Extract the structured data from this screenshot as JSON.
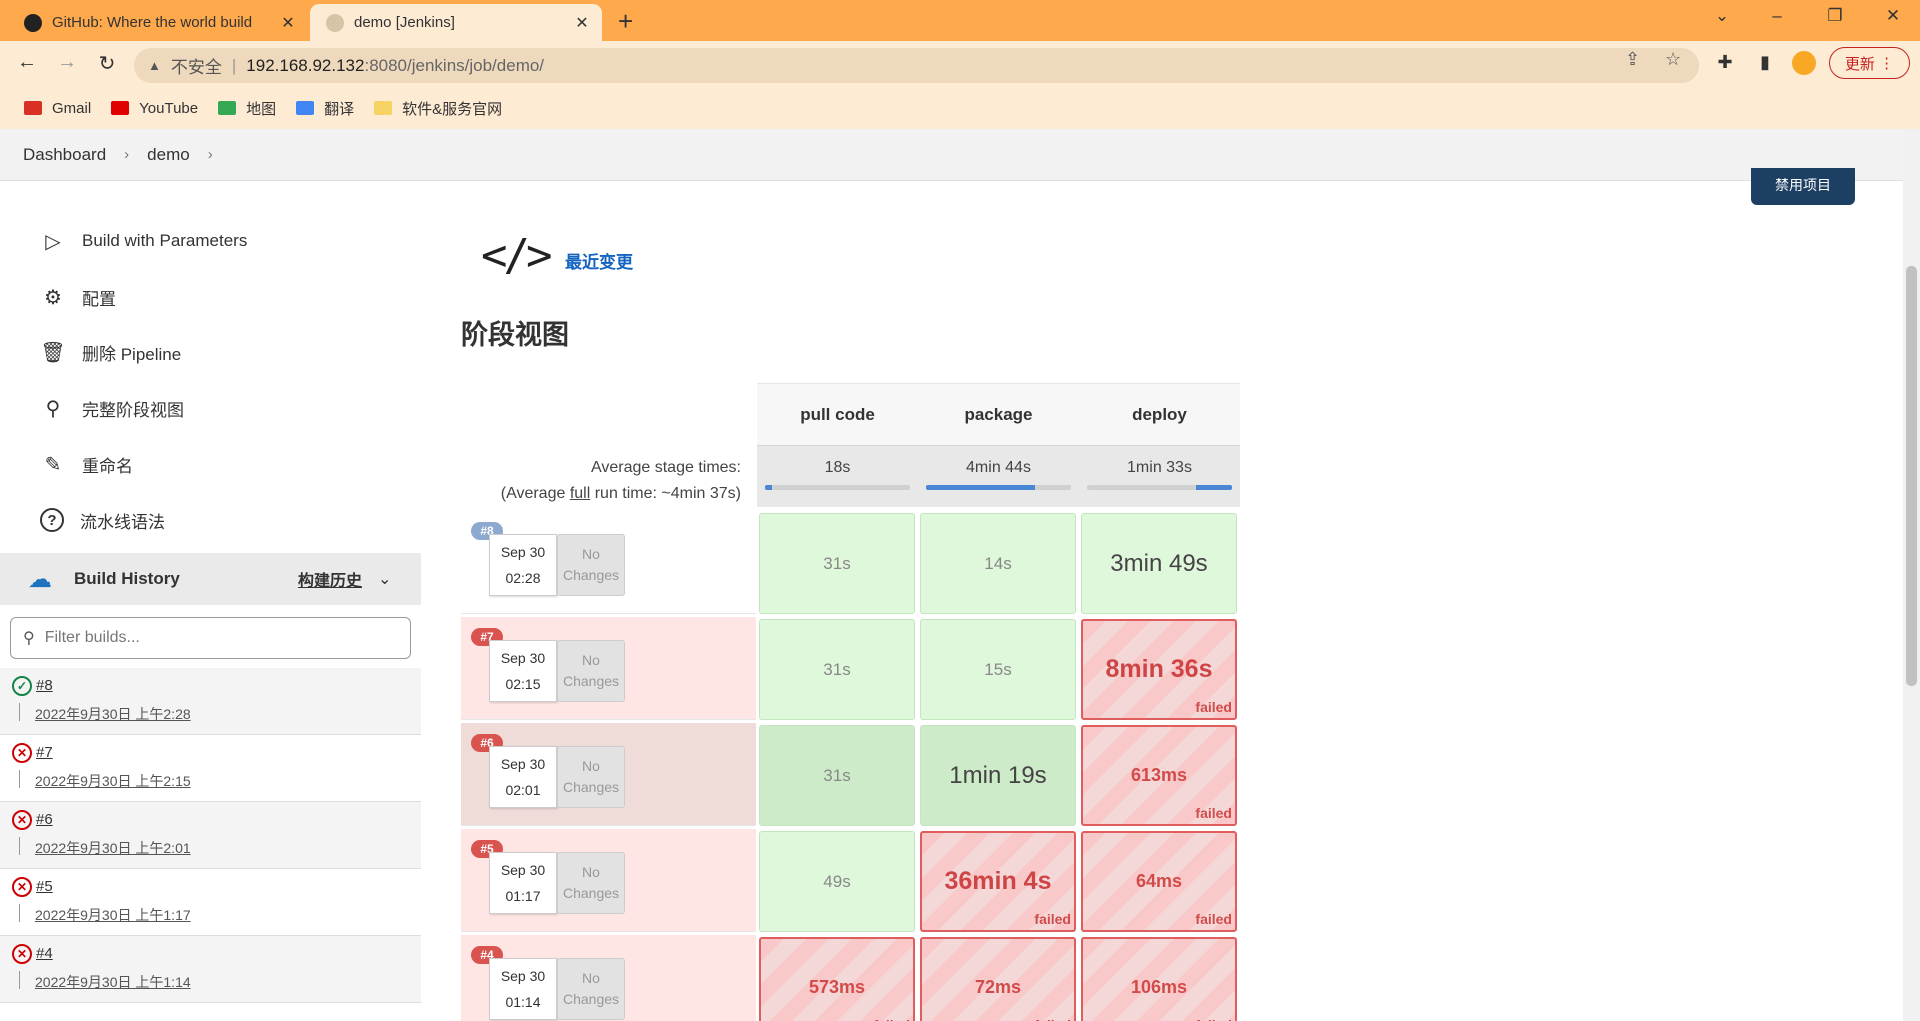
{
  "browser": {
    "tabs": [
      {
        "title": "GitHub: Where the world build",
        "active": false
      },
      {
        "title": "demo [Jenkins]",
        "active": true
      }
    ],
    "address": {
      "insecure_label": "不安全",
      "host": "192.168.92.132",
      "path": ":8080/jenkins/job/demo/"
    },
    "update_label": "更新",
    "bookmarks": [
      {
        "label": "Gmail",
        "icon": "gmail-icon",
        "color": "#d93025"
      },
      {
        "label": "YouTube",
        "icon": "youtube-icon",
        "color": "#e00000"
      },
      {
        "label": "地图",
        "icon": "maps-icon",
        "color": "#34a853"
      },
      {
        "label": "翻译",
        "icon": "translate-icon",
        "color": "#4285f4"
      },
      {
        "label": "软件&服务官网",
        "icon": "folder-icon",
        "color": "#f6d365"
      }
    ]
  },
  "breadcrumb": [
    "Dashboard",
    "demo"
  ],
  "header": {
    "jump_button": "禁用项目"
  },
  "sidebar": {
    "tasks": [
      {
        "label": "Build with Parameters",
        "icon": "play-icon"
      },
      {
        "label": "配置",
        "icon": "gear-icon"
      },
      {
        "label": "删除 Pipeline",
        "icon": "trash-icon"
      },
      {
        "label": "完整阶段视图",
        "icon": "search-icon"
      },
      {
        "label": "重命名",
        "icon": "pencil-icon"
      },
      {
        "label": "流水线语法",
        "icon": "help-icon"
      }
    ],
    "build_history": {
      "title": "Build History",
      "trend_link": "构建历史",
      "filter_placeholder": "Filter builds...",
      "builds": [
        {
          "number": "#8",
          "date": "2022年9月30日 上午2:28",
          "status": "success"
        },
        {
          "number": "#7",
          "date": "2022年9月30日 上午2:15",
          "status": "failed"
        },
        {
          "number": "#6",
          "date": "2022年9月30日 上午2:01",
          "status": "failed"
        },
        {
          "number": "#5",
          "date": "2022年9月30日 上午1:17",
          "status": "failed"
        },
        {
          "number": "#4",
          "date": "2022年9月30日 上午1:14",
          "status": "failed"
        }
      ]
    }
  },
  "main": {
    "recent_changes": "最近变更",
    "stage_view_title": "阶段视图",
    "avg_stage_label": "Average stage times:",
    "avg_full_prefix": "(Average ",
    "avg_full_word": "full",
    "avg_full_suffix": " run time: ~4min 37s)",
    "stages": [
      {
        "name": "pull code",
        "avg": "18s",
        "avg_fraction": 0.05
      },
      {
        "name": "package",
        "avg": "4min 44s",
        "avg_fraction": 0.75
      },
      {
        "name": "deploy",
        "avg": "1min 33s",
        "avg_fraction": 0.25
      }
    ],
    "runs": [
      {
        "badge": "#8",
        "badge_color": "#8ea9cf",
        "row_color": "#ffffff",
        "date": "Sep 30",
        "time": "02:28",
        "changes": [
          "No",
          "Changes"
        ],
        "cells": [
          {
            "text": "31s",
            "status": "ok"
          },
          {
            "text": "14s",
            "status": "ok"
          },
          {
            "text": "3min 49s",
            "status": "ok",
            "big": true
          }
        ]
      },
      {
        "badge": "#7",
        "badge_color": "#d9534f",
        "row_color": "#ffe6e4",
        "date": "Sep 30",
        "time": "02:15",
        "changes": [
          "No",
          "Changes"
        ],
        "cells": [
          {
            "text": "31s",
            "status": "ok"
          },
          {
            "text": "15s",
            "status": "ok"
          },
          {
            "text": "8min 36s",
            "status": "fail",
            "big": true,
            "note": "failed"
          }
        ]
      },
      {
        "badge": "#6",
        "badge_color": "#d9534f",
        "row_color": "#efdbd8",
        "date": "Sep 30",
        "time": "02:01",
        "changes": [
          "No",
          "Changes"
        ],
        "cells": [
          {
            "text": "31s",
            "status": "ok",
            "dark": true
          },
          {
            "text": "1min 19s",
            "status": "ok",
            "dark": true,
            "big": true
          },
          {
            "text": "613ms",
            "status": "fail",
            "note": "failed"
          }
        ]
      },
      {
        "badge": "#5",
        "badge_color": "#d9534f",
        "row_color": "#ffe6e4",
        "date": "Sep 30",
        "time": "01:17",
        "changes": [
          "No",
          "Changes"
        ],
        "cells": [
          {
            "text": "49s",
            "status": "ok"
          },
          {
            "text": "36min 4s",
            "status": "fail",
            "big": true,
            "note": "failed"
          },
          {
            "text": "64ms",
            "status": "fail",
            "note": "failed"
          }
        ]
      },
      {
        "badge": "#4",
        "badge_color": "#d9534f",
        "row_color": "#ffe6e4",
        "date": "Sep 30",
        "time": "01:14",
        "changes": [
          "No",
          "Changes"
        ],
        "cells": [
          {
            "text": "573ms",
            "status": "fail",
            "note": "failed"
          },
          {
            "text": "72ms",
            "status": "fail",
            "note": "failed"
          },
          {
            "text": "106ms",
            "status": "fail",
            "note": "failed"
          }
        ]
      }
    ]
  }
}
